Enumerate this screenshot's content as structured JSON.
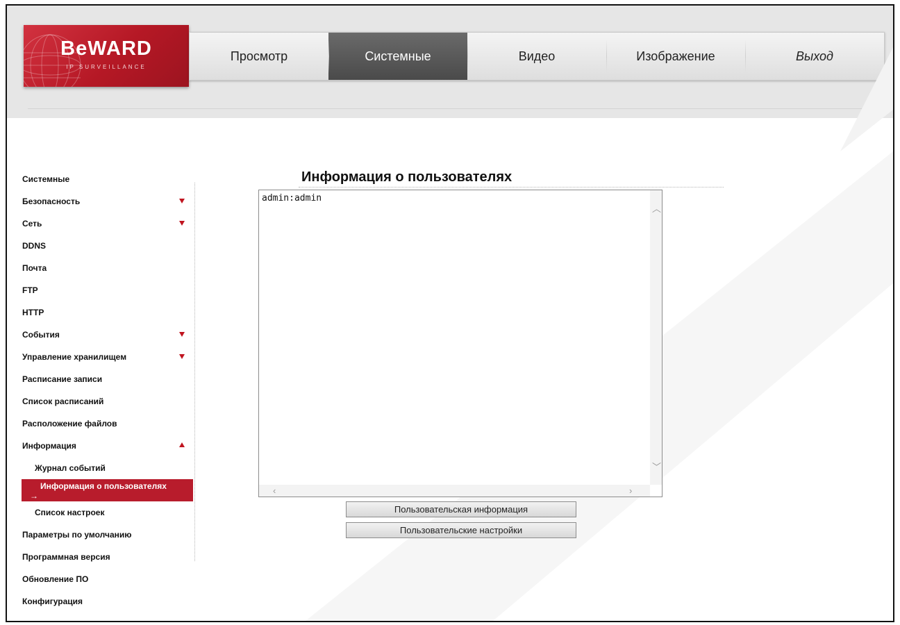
{
  "brand": {
    "logo_text": "BeWARD",
    "logo_subtitle": "IP SURVEILLANCE",
    "accent_color": "#b81c2c"
  },
  "nav": {
    "items": [
      {
        "label": "Просмотр",
        "active": false
      },
      {
        "label": "Системные",
        "active": true
      },
      {
        "label": "Видео",
        "active": false
      },
      {
        "label": "Изображение",
        "active": false
      },
      {
        "label": "Выход",
        "active": false
      }
    ]
  },
  "sidebar": {
    "items": [
      {
        "label": "Системные",
        "expandable": false
      },
      {
        "label": "Безопасность",
        "expandable": true,
        "expanded": false
      },
      {
        "label": "Сеть",
        "expandable": true,
        "expanded": false
      },
      {
        "label": "DDNS",
        "expandable": false
      },
      {
        "label": "Почта",
        "expandable": false
      },
      {
        "label": "FTP",
        "expandable": false
      },
      {
        "label": "HTTP",
        "expandable": false
      },
      {
        "label": "События",
        "expandable": true,
        "expanded": false
      },
      {
        "label": "Управление хранилищем",
        "expandable": true,
        "expanded": false
      },
      {
        "label": "Расписание записи",
        "expandable": false
      },
      {
        "label": "Список расписаний",
        "expandable": false
      },
      {
        "label": "Расположение файлов",
        "expandable": false
      },
      {
        "label": "Информация",
        "expandable": true,
        "expanded": true
      },
      {
        "label": "Журнал событий",
        "sub": true
      },
      {
        "label": "Информация о пользователях",
        "sub": true,
        "selected": true,
        "marker": "→"
      },
      {
        "label": "Список настроек",
        "sub": true
      },
      {
        "label": "Параметры по умолчанию",
        "expandable": false
      },
      {
        "label": "Программная версия",
        "expandable": false
      },
      {
        "label": "Обновление ПО",
        "expandable": false
      },
      {
        "label": "Конфигурация",
        "expandable": false
      }
    ]
  },
  "main": {
    "title": "Информация о пользователях",
    "textarea_value": "admin:admin",
    "buttons": {
      "user_info": "Пользовательская информация",
      "user_settings": "Пользовательские настройки"
    }
  }
}
